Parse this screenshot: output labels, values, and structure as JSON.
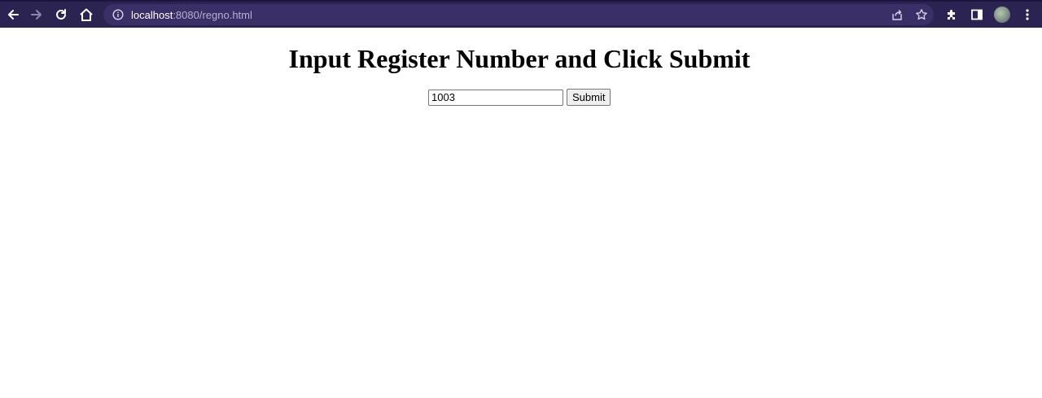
{
  "browser": {
    "url_host": "localhost",
    "url_rest": ":8080/regno.html",
    "colors": {
      "toolbar": "#2b2352",
      "omnibox": "#3a2f66"
    },
    "icons": {
      "back": "arrow-left-icon",
      "forward": "arrow-right-icon",
      "reload": "reload-icon",
      "home": "home-icon",
      "site_info": "info-icon",
      "share": "share-icon",
      "bookmark": "star-icon",
      "extensions": "puzzle-icon",
      "side_panel": "side-panel-icon",
      "profile": "avatar",
      "menu": "kebab-menu-icon"
    }
  },
  "page": {
    "title": "Input Register Number and Click Submit",
    "form": {
      "register_number_value": "1003",
      "submit_label": "Submit"
    }
  }
}
